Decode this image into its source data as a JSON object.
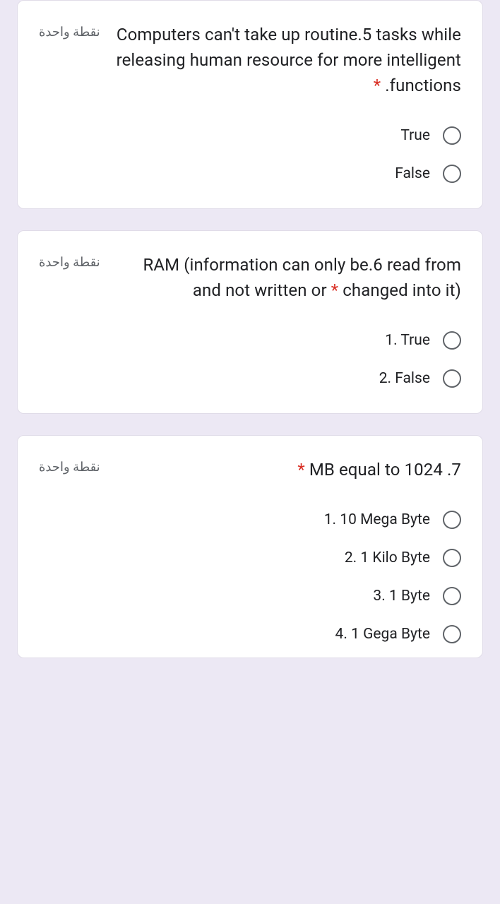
{
  "points_label": "نقطة واحدة",
  "asterisk": "*",
  "questions": [
    {
      "text_part1": "Computers can't take up routine.5 tasks while releasing human resource for more intelligent .functions",
      "text_html": "Computers can't take up routine.5 tasks while releasing human resource for more intelligent ",
      "text_suffix": " .functions",
      "options": [
        "True",
        "False"
      ]
    },
    {
      "text_html": "RAM (information can only be.6 read from and not written or ",
      "text_suffix": " changed into it)",
      "options": [
        "1. True",
        "2. False"
      ]
    },
    {
      "text_html": "",
      "text_suffix": " MB equal to 1024 .7",
      "options": [
        "1. 10 Mega Byte",
        "2. 1 Kilo Byte",
        "3. 1 Byte",
        "4. 1 Gega Byte"
      ]
    }
  ]
}
